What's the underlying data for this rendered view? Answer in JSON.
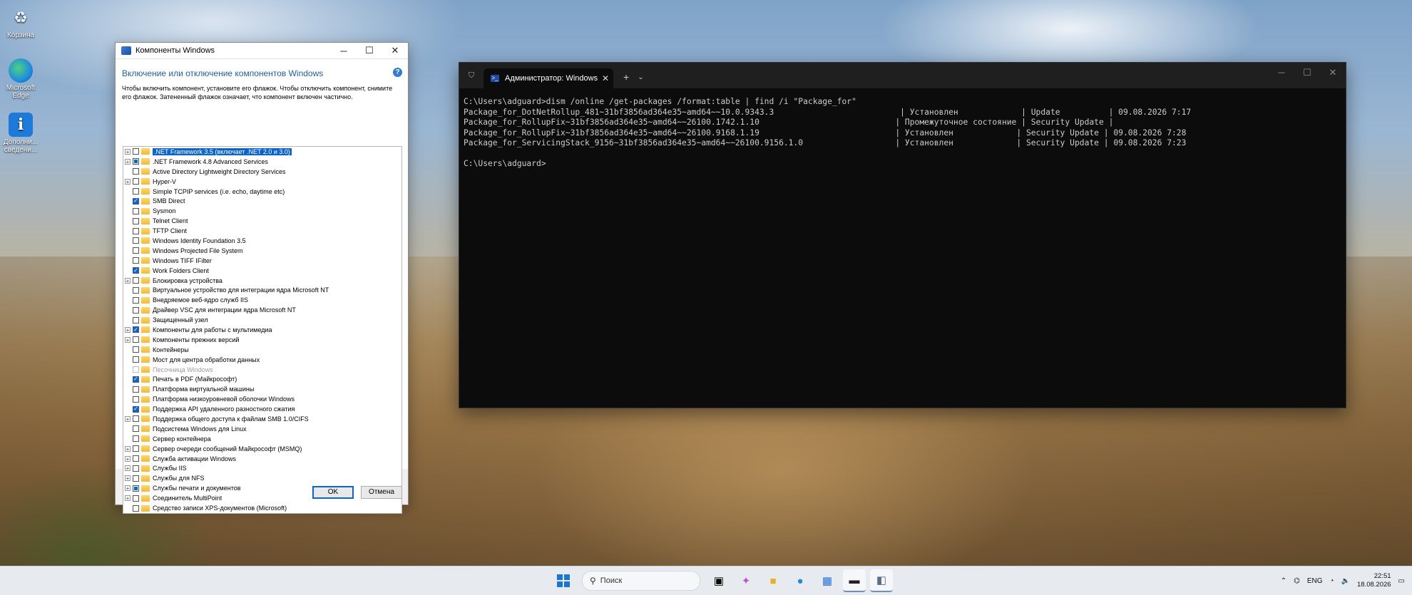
{
  "desktop": {
    "icons": [
      {
        "label": "Корзина",
        "icon": "recycle-bin-icon"
      },
      {
        "label": "Microsoft Edge",
        "icon": "edge-icon"
      },
      {
        "label": "Дополни... сведени...",
        "icon": "info-icon"
      }
    ]
  },
  "features_dialog": {
    "title": "Компоненты Windows",
    "heading": "Включение или отключение компонентов Windows",
    "description": "Чтобы включить компонент, установите его флажок. Чтобы отключить компонент, снимите его флажок. Затененный флажок означает, что компонент включен частично.",
    "items": [
      {
        "label": ".NET Framework 3.5 (включает .NET 2.0 и 3.0)",
        "state": "off",
        "expandable": true,
        "selected": true
      },
      {
        "label": ".NET Framework 4.8 Advanced Services",
        "state": "partial",
        "expandable": true
      },
      {
        "label": "Active Directory Lightweight Directory Services",
        "state": "off",
        "expandable": false
      },
      {
        "label": "Hyper-V",
        "state": "off",
        "expandable": true
      },
      {
        "label": "Simple TCPIP services (i.e. echo, daytime etc)",
        "state": "off",
        "expandable": false
      },
      {
        "label": "SMB Direct",
        "state": "on",
        "expandable": false
      },
      {
        "label": "Sysmon",
        "state": "off",
        "expandable": false
      },
      {
        "label": "Telnet Client",
        "state": "off",
        "expandable": false
      },
      {
        "label": "TFTP Client",
        "state": "off",
        "expandable": false
      },
      {
        "label": "Windows Identity Foundation 3.5",
        "state": "off",
        "expandable": false
      },
      {
        "label": "Windows Projected File System",
        "state": "off",
        "expandable": false
      },
      {
        "label": "Windows TIFF IFilter",
        "state": "off",
        "expandable": false
      },
      {
        "label": "Work Folders Client",
        "state": "on",
        "expandable": false
      },
      {
        "label": "Блокировка устройства",
        "state": "off",
        "expandable": true
      },
      {
        "label": "Виртуальное устройство для интеграции ядра Microsoft NT",
        "state": "off",
        "expandable": false
      },
      {
        "label": "Внедряемое веб-ядро служб IIS",
        "state": "off",
        "expandable": false
      },
      {
        "label": "Драйвер VSC для интеграции ядра Microsoft NT",
        "state": "off",
        "expandable": false
      },
      {
        "label": "Защищенный узел",
        "state": "off",
        "expandable": false
      },
      {
        "label": "Компоненты для работы с мультимедиа",
        "state": "on",
        "expandable": true
      },
      {
        "label": "Компоненты прежних версий",
        "state": "off",
        "expandable": true
      },
      {
        "label": "Контейнеры",
        "state": "off",
        "expandable": false
      },
      {
        "label": "Мост для центра обработки данных",
        "state": "off",
        "expandable": false
      },
      {
        "label": "Песочница Windows",
        "state": "disabled",
        "expandable": false
      },
      {
        "label": "Печать в PDF (Майкрософт)",
        "state": "on",
        "expandable": false
      },
      {
        "label": "Платформа виртуальной машины",
        "state": "off",
        "expandable": false
      },
      {
        "label": "Платформа низкоуровневой оболочки Windows",
        "state": "off",
        "expandable": false
      },
      {
        "label": "Поддержка API удаленного разностного сжатия",
        "state": "on",
        "expandable": false
      },
      {
        "label": "Поддержка общего доступа к файлам SMB 1.0/CIFS",
        "state": "off",
        "expandable": true
      },
      {
        "label": "Подсистема Windows для Linux",
        "state": "off",
        "expandable": false
      },
      {
        "label": "Сервер контейнера",
        "state": "off",
        "expandable": false
      },
      {
        "label": "Сервер очереди сообщений Майкрософт (MSMQ)",
        "state": "off",
        "expandable": true
      },
      {
        "label": "Служба активации Windows",
        "state": "off",
        "expandable": true
      },
      {
        "label": "Службы IIS",
        "state": "off",
        "expandable": true
      },
      {
        "label": "Службы для NFS",
        "state": "off",
        "expandable": true
      },
      {
        "label": "Службы печати и документов",
        "state": "partial",
        "expandable": true
      },
      {
        "label": "Соединитель MultiPoint",
        "state": "off",
        "expandable": true
      },
      {
        "label": "Средство записи XPS-документов (Microsoft)",
        "state": "off",
        "expandable": false
      }
    ],
    "ok_label": "OK",
    "cancel_label": "Отмена"
  },
  "terminal": {
    "tab_title": "Администратор: Windows Po",
    "lines": [
      "C:\\Users\\adguard>dism /online /get-packages /format:table | find /i \"Package_for\"",
      "Package_for_DotNetRollup_481~31bf3856ad364e35~amd64~~10.0.9343.3                          | Установлен             | Update          | 09.08.2026 7:17",
      "Package_for_RollupFix~31bf3856ad364e35~amd64~~26100.1742.1.10                            | Промежуточное состояние | Security Update |",
      "Package_for_RollupFix~31bf3856ad364e35~amd64~~26100.9168.1.19                            | Установлен             | Security Update | 09.08.2026 7:28",
      "Package_for_ServicingStack_9156~31bf3856ad364e35~amd64~~26100.9156.1.0                   | Установлен             | Security Update | 09.08.2026 7:23",
      "",
      "C:\\Users\\adguard>"
    ]
  },
  "taskbar": {
    "search_placeholder": "Поиск",
    "language": "ENG",
    "time": "22:51",
    "date": "18.08.2026"
  }
}
